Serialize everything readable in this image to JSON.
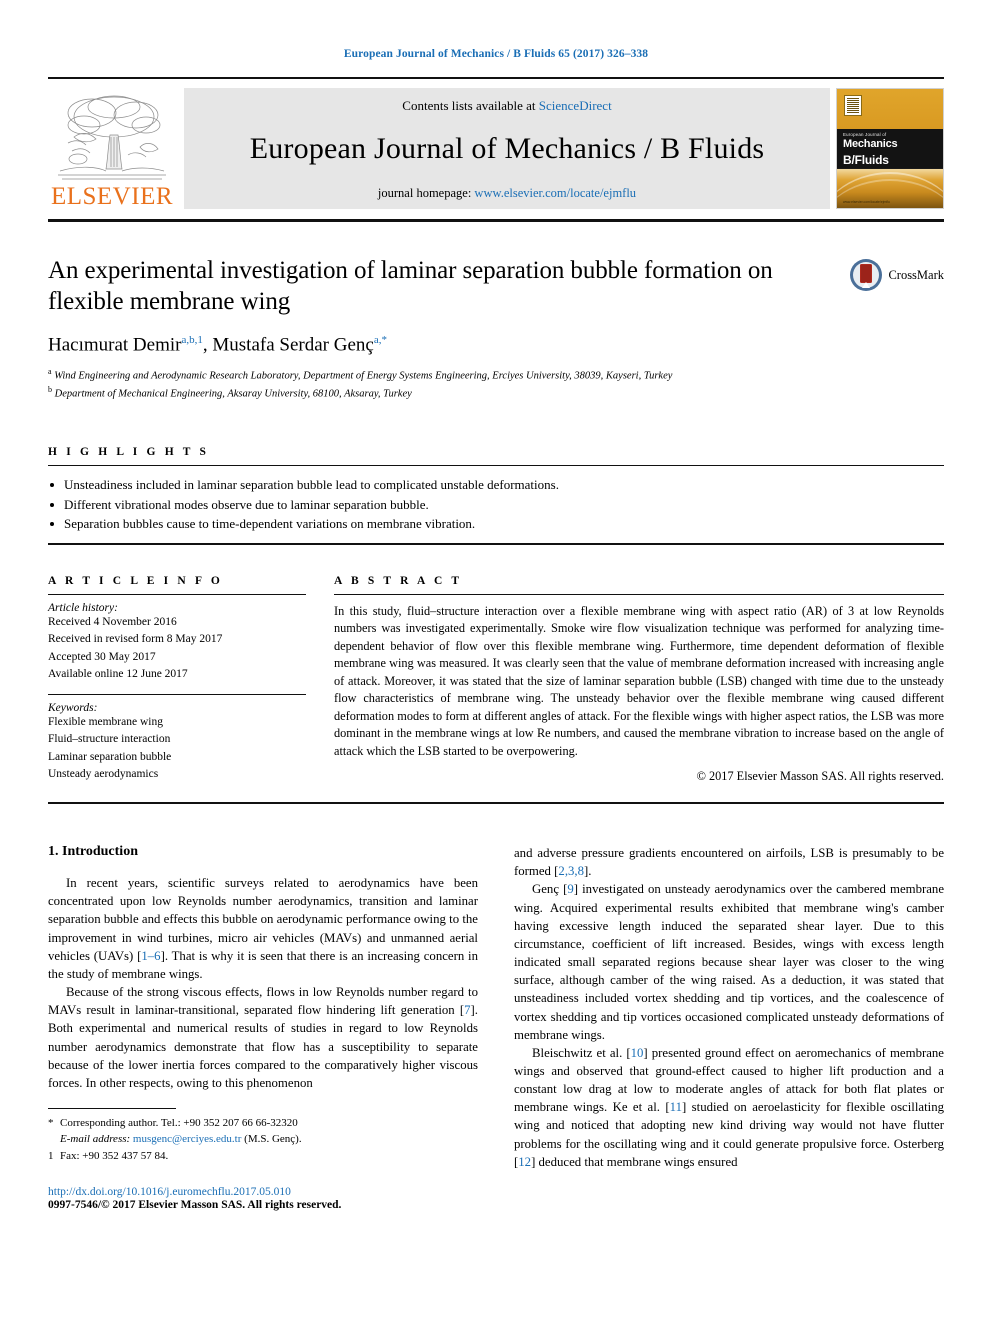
{
  "running_head": "European Journal of Mechanics / B Fluids 65 (2017) 326–338",
  "masthead": {
    "publisher": "ELSEVIER",
    "contents_prefix": "Contents lists available at ",
    "contents_link": "ScienceDirect",
    "journal_title": "European Journal of Mechanics / B Fluids",
    "homepage_prefix": "journal homepage: ",
    "homepage_link": "www.elsevier.com/locate/ejmflu",
    "cover": {
      "line1": "European Journal of",
      "line2": "Mechanics",
      "line3": "B/Fluids",
      "url": "www.elsevier.com/locate/ejmflu"
    }
  },
  "article": {
    "title": "An experimental investigation of laminar separation bubble formation on flexible membrane wing",
    "authors": [
      {
        "name": "Hacımurat Demir",
        "marks": "a,b,1"
      },
      {
        "name": "Mustafa Serdar Genç",
        "marks": "a,*"
      }
    ],
    "affiliations": [
      {
        "mark": "a",
        "text": "Wind Engineering and Aerodynamic Research Laboratory, Department of Energy Systems Engineering, Erciyes University, 38039, Kayseri, Turkey"
      },
      {
        "mark": "b",
        "text": "Department of Mechanical Engineering, Aksaray University, 68100, Aksaray, Turkey"
      }
    ],
    "crossmark_label": "CrossMark"
  },
  "highlights": {
    "heading": "H I G H L I G H T S",
    "items": [
      "Unsteadiness included in laminar separation bubble lead to complicated unstable deformations.",
      "Different vibrational modes observe due to laminar separation bubble.",
      "Separation bubbles cause to time-dependent variations on membrane vibration."
    ]
  },
  "article_info": {
    "heading": "A R T I C L E    I N F O",
    "history_title": "Article history:",
    "history": [
      "Received 4 November 2016",
      "Received in revised form 8 May 2017",
      "Accepted 30 May 2017",
      "Available online 12 June 2017"
    ],
    "keywords_title": "Keywords:",
    "keywords": [
      "Flexible membrane wing",
      "Fluid–structure interaction",
      "Laminar separation bubble",
      "Unsteady aerodynamics"
    ]
  },
  "abstract": {
    "heading": "A B S T R A C T",
    "text": "In this study, fluid–structure interaction over a flexible membrane wing with aspect ratio (AR) of 3 at low Reynolds numbers was investigated experimentally. Smoke wire flow visualization technique was performed for analyzing time-dependent behavior of flow over this flexible membrane wing. Furthermore, time dependent deformation of flexible membrane wing was measured. It was clearly seen that the value of membrane deformation increased with increasing angle of attack. Moreover, it was stated that the size of laminar separation bubble (LSB) changed with time due to the unsteady flow characteristics of membrane wing. The unsteady behavior over the flexible membrane wing caused different deformation modes to form at different angles of attack. For the flexible wings with higher aspect ratios, the LSB was more dominant in the membrane wings at low Re numbers, and caused the membrane vibration to increase based on the angle of attack which the LSB started to be overpowering.",
    "copyright": "© 2017 Elsevier Masson SAS. All rights reserved."
  },
  "body": {
    "section_title": "1. Introduction",
    "left_paragraphs": [
      "In recent years, scientific surveys related to aerodynamics have been concentrated upon low Reynolds number aerodynamics, transition and laminar separation bubble and effects this bubble on aerodynamic performance owing to the improvement in wind turbines, micro air vehicles (MAVs) and unmanned aerial vehicles (UAVs) [1–6]. That is why it is seen that there is an increasing concern in the study of membrane wings.",
      "Because of the strong viscous effects, flows in low Reynolds number regard to MAVs result in laminar-transitional, separated flow hindering lift generation [7]. Both experimental and numerical results of studies in regard to low Reynolds number aerodynamics demonstrate that flow has a susceptibility to separate because of the lower inertia forces compared to the comparatively higher viscous forces. In other respects, owing to this phenomenon"
    ],
    "right_paragraphs": [
      "and adverse pressure gradients encountered on airfoils, LSB is presumably to be formed [2,3,8].",
      "Genç [9] investigated on unsteady aerodynamics over the cambered membrane wing. Acquired experimental results exhibited that membrane wing's camber having excessive length induced the separated shear layer. Due to this circumstance, coefficient of lift increased. Besides, wings with excess length indicated small separated regions because shear layer was closer to the wing surface, although camber of the wing raised. As a deduction, it was stated that unsteadiness included vortex shedding and tip vortices, and the coalescence of vortex shedding and tip vortices occasioned complicated unsteady deformations of membrane wings.",
      "Bleischwitz et al. [10] presented ground effect on aeromechanics of membrane wings and observed that ground-effect caused to higher lift production and a constant low drag at low to moderate angles of attack for both flat plates or membrane wings. Ke et al. [11] studied on aeroelasticity for flexible oscillating wing and noticed that adopting new kind driving way would not have flutter problems for the oscillating wing and it could generate propulsive force. Osterberg [12] deduced that membrane wings ensured"
    ]
  },
  "footnotes": {
    "corresponding": "Corresponding author. Tel.: +90 352 207 66 66-32320",
    "email_label": "E-mail address:",
    "email": "musgenc@erciyes.edu.tr",
    "email_owner": "(M.S. Genç).",
    "fax": "Fax: +90 352 437 57 84.",
    "doi": "http://dx.doi.org/10.1016/j.euromechflu.2017.05.010",
    "issn": "0997-7546/© 2017 Elsevier Masson SAS. All rights reserved."
  },
  "colors": {
    "link": "#1a6eb5",
    "elsevier_orange": "#E9711C",
    "cover_gold": "#d99a22"
  }
}
